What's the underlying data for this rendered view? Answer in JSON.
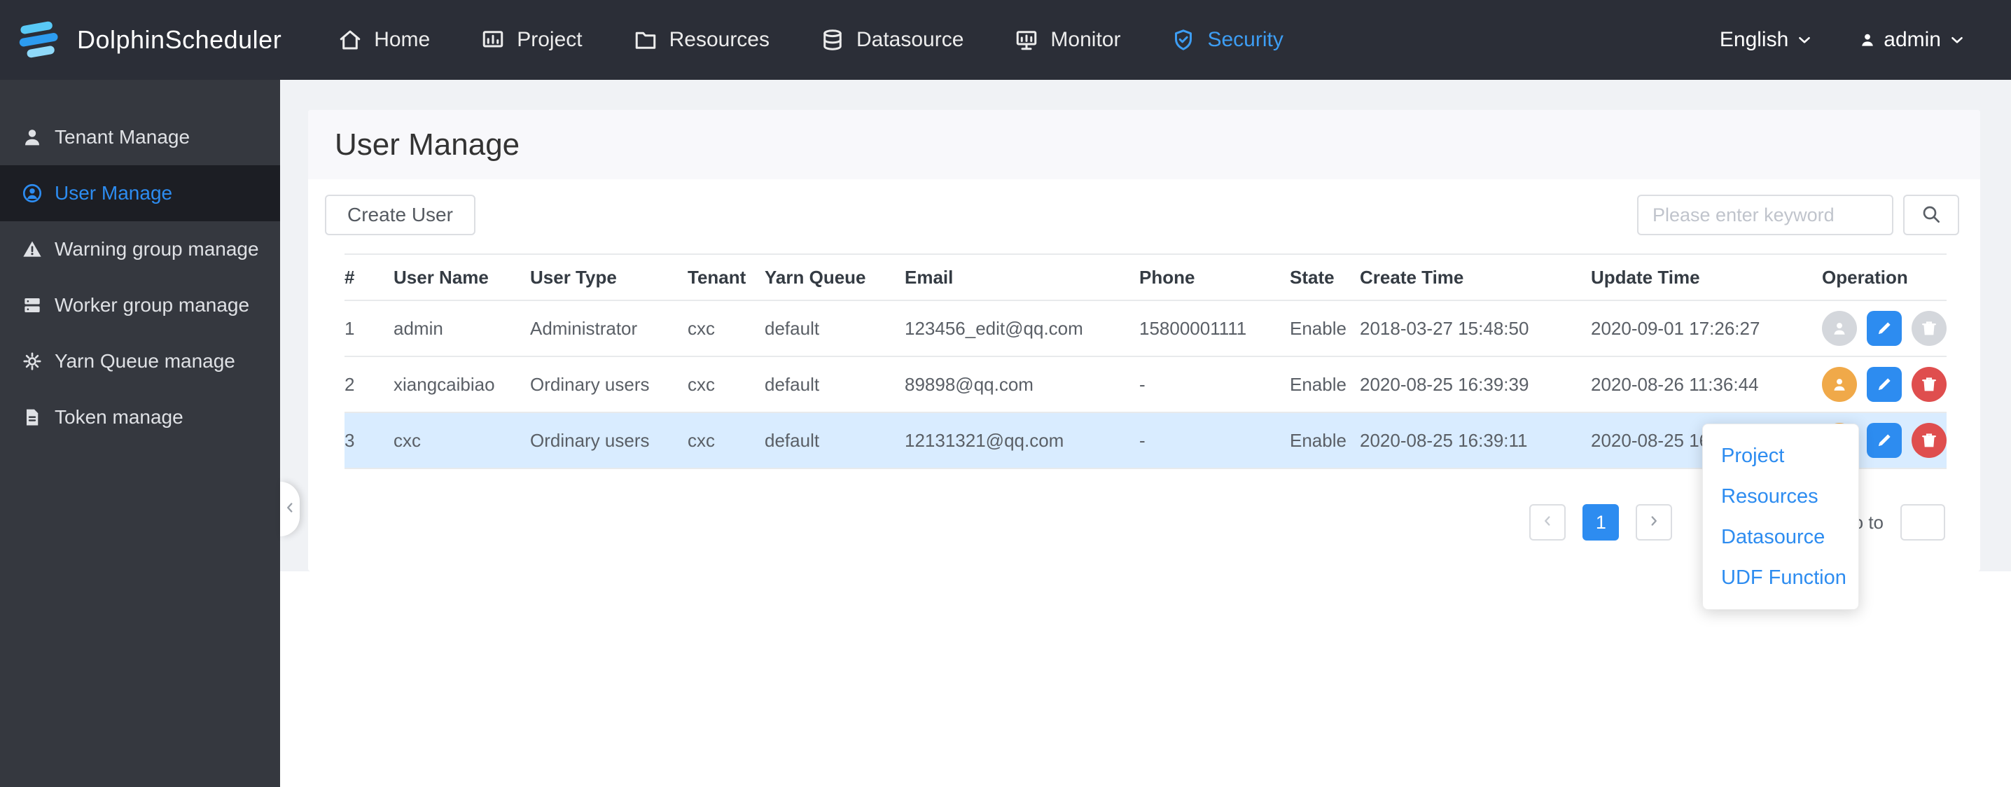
{
  "navbar": {
    "brand": "DolphinScheduler",
    "items": [
      {
        "label": "Home"
      },
      {
        "label": "Project"
      },
      {
        "label": "Resources"
      },
      {
        "label": "Datasource"
      },
      {
        "label": "Monitor"
      },
      {
        "label": "Security",
        "active": true
      }
    ],
    "language": "English",
    "user": "admin"
  },
  "sidebar": {
    "items": [
      {
        "label": "Tenant Manage"
      },
      {
        "label": "User Manage",
        "active": true
      },
      {
        "label": "Warning group manage"
      },
      {
        "label": "Worker group manage"
      },
      {
        "label": "Yarn Queue manage"
      },
      {
        "label": "Token manage"
      }
    ]
  },
  "page": {
    "title": "User Manage"
  },
  "toolbar": {
    "create_user_label": "Create User",
    "search_placeholder": "Please enter keyword"
  },
  "table": {
    "headers": [
      "#",
      "User Name",
      "User Type",
      "Tenant",
      "Yarn Queue",
      "Email",
      "Phone",
      "State",
      "Create Time",
      "Update Time",
      "Operation"
    ],
    "rows": [
      {
        "index": "1",
        "user_name": "admin",
        "user_type": "Administrator",
        "tenant": "cxc",
        "yarn_queue": "default",
        "email": "123456_edit@qq.com",
        "phone": "15800001111",
        "state": "Enable",
        "create_time": "2018-03-27 15:48:50",
        "update_time": "2020-09-01 17:26:27"
      },
      {
        "index": "2",
        "user_name": "xiangcaibiao",
        "user_type": "Ordinary users",
        "tenant": "cxc",
        "yarn_queue": "default",
        "email": "89898@qq.com",
        "phone": "-",
        "state": "Enable",
        "create_time": "2020-08-25 16:39:39",
        "update_time": "2020-08-26 11:36:44"
      },
      {
        "index": "3",
        "user_name": "cxc",
        "user_type": "Ordinary users",
        "tenant": "cxc",
        "yarn_queue": "default",
        "email": "12131321@qq.com",
        "phone": "-",
        "state": "Enable",
        "create_time": "2020-08-25 16:39:11",
        "update_time": "2020-08-25 16:39:11"
      }
    ]
  },
  "authorize_menu": {
    "items": [
      {
        "label": "Project"
      },
      {
        "label": "Resources"
      },
      {
        "label": "Datasource"
      },
      {
        "label": "UDF Function"
      }
    ]
  },
  "pagination": {
    "current_page": "1",
    "go_to_label": "Go to"
  },
  "colors": {
    "primary_blue": "#2d8cf0",
    "security_blue": "#3d9df3",
    "authorize_orange": "#f0a949",
    "delete_red": "#df4e4e",
    "row_highlight": "#d9ecff",
    "navbar_bg": "#2b2e37",
    "sidebar_bg": "#35383f"
  },
  "icons": {
    "logo": "dolphinscheduler-logo",
    "nav": [
      "home",
      "project",
      "resources",
      "datasource",
      "monitor",
      "security-shield"
    ],
    "sidebar": [
      "tenant-person",
      "user-circle",
      "warning-triangle",
      "worker-server",
      "yarn-queue-gear",
      "token-file"
    ],
    "operations": [
      "authorize-user",
      "edit-pencil",
      "delete-trash"
    ],
    "search": "magnifier",
    "chevrons": [
      "chevron-down",
      "chevron-left",
      "chevron-right"
    ]
  }
}
